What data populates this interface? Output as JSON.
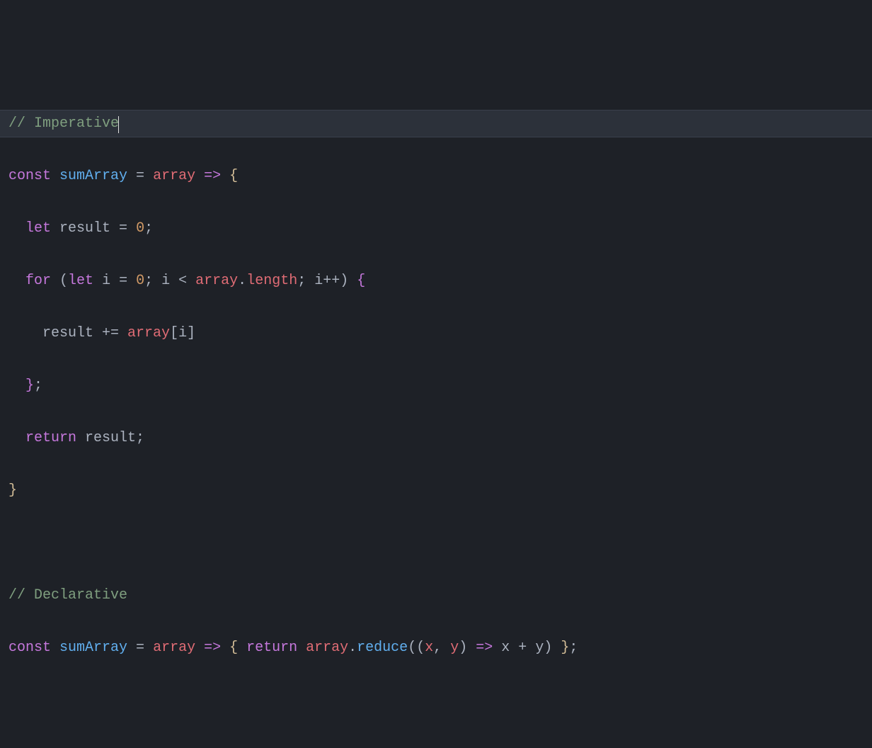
{
  "code": {
    "line1": {
      "comment": "// Imperative"
    },
    "line2": {
      "const": "const",
      "name": "sumArray",
      "eq": " = ",
      "param": "array",
      "arrow": " => ",
      "brace": "{"
    },
    "line3": {
      "indent": "  ",
      "let": "let",
      "name": " result ",
      "eq": "= ",
      "zero": "0",
      "semi": ";"
    },
    "line4": {
      "indent": "  ",
      "for": "for",
      "open": " (",
      "let": "let",
      "i": " i ",
      "eq": "= ",
      "zero": "0",
      "semi1": "; ",
      "i2": "i ",
      "lt": "< ",
      "array": "array",
      "dot": ".",
      "length": "length",
      "semi2": "; ",
      "i3": "i",
      "inc": "++",
      "close": ") ",
      "brace": "{"
    },
    "line5": {
      "indent": "    ",
      "result": "result ",
      "pluseq": "+= ",
      "array": "array",
      "open": "[",
      "i": "i",
      "close": "]"
    },
    "line6": {
      "indent": "  ",
      "brace": "}",
      "semi": ";"
    },
    "line7": {
      "indent": "  ",
      "return": "return",
      "result": " result",
      "semi": ";"
    },
    "line8": {
      "brace": "}"
    },
    "line9": {
      "blank": " "
    },
    "line10": {
      "comment": "// Declarative"
    },
    "line11": {
      "const": "const",
      "name": " sumArray ",
      "eq": "= ",
      "param": "array",
      "arrow": " => ",
      "brace1": "{ ",
      "return": "return",
      "sp": " ",
      "array": "array",
      "dot": ".",
      "reduce": "reduce",
      "open": "((",
      "x": "x",
      "comma": ", ",
      "y": "y",
      "close1": ")",
      "arrow2": " => ",
      "x2": "x ",
      "plus": "+ ",
      "y2": "y",
      "close2": ") ",
      "brace2": "}",
      "semi": ";"
    }
  }
}
